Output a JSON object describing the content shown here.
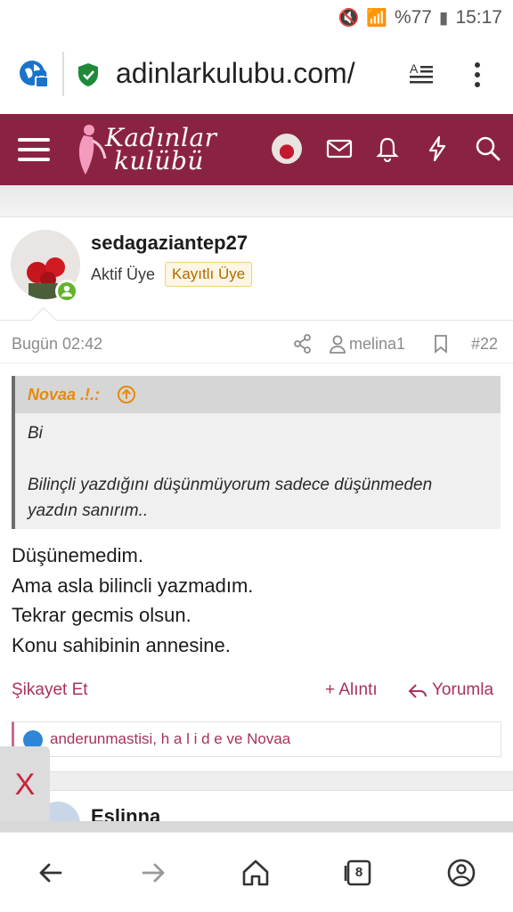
{
  "statusbar": {
    "battery": "%77",
    "time": "15:17"
  },
  "browser": {
    "url": "adinlarkulubu.com/",
    "tab_count": "8"
  },
  "site": {
    "logo_line1": "Kadınlar",
    "logo_line2": "kulübü",
    "nav_color": "#8a2342"
  },
  "post": {
    "username": "sedagaziantep27",
    "user_title": "Aktif Üye",
    "badge": "Kayıtlı Üye",
    "time": "Bugün 02:42",
    "mention_user": "melina1",
    "post_number": "#22",
    "quote": {
      "author": "Novaa .!.:",
      "line1": "Bi",
      "line2": "Bilinçli yazdığını düşünmüyorum sadece düşünmeden",
      "line3": "yazdın sanırım.."
    },
    "body": [
      "Düşünemedim.",
      "Ama asla bilincli yazmadım.",
      "Tekrar gecmis olsun.",
      "Konu sahibinin annesine."
    ],
    "actions": {
      "report": "Şikayet Et",
      "quote": "+ Alıntı",
      "reply": "Yorumla"
    },
    "reactions": "anderunmastisi, h a l i d e ve Novaa"
  },
  "next_post": {
    "username": "Eslinna"
  },
  "overlay": {
    "close_label": "X"
  }
}
